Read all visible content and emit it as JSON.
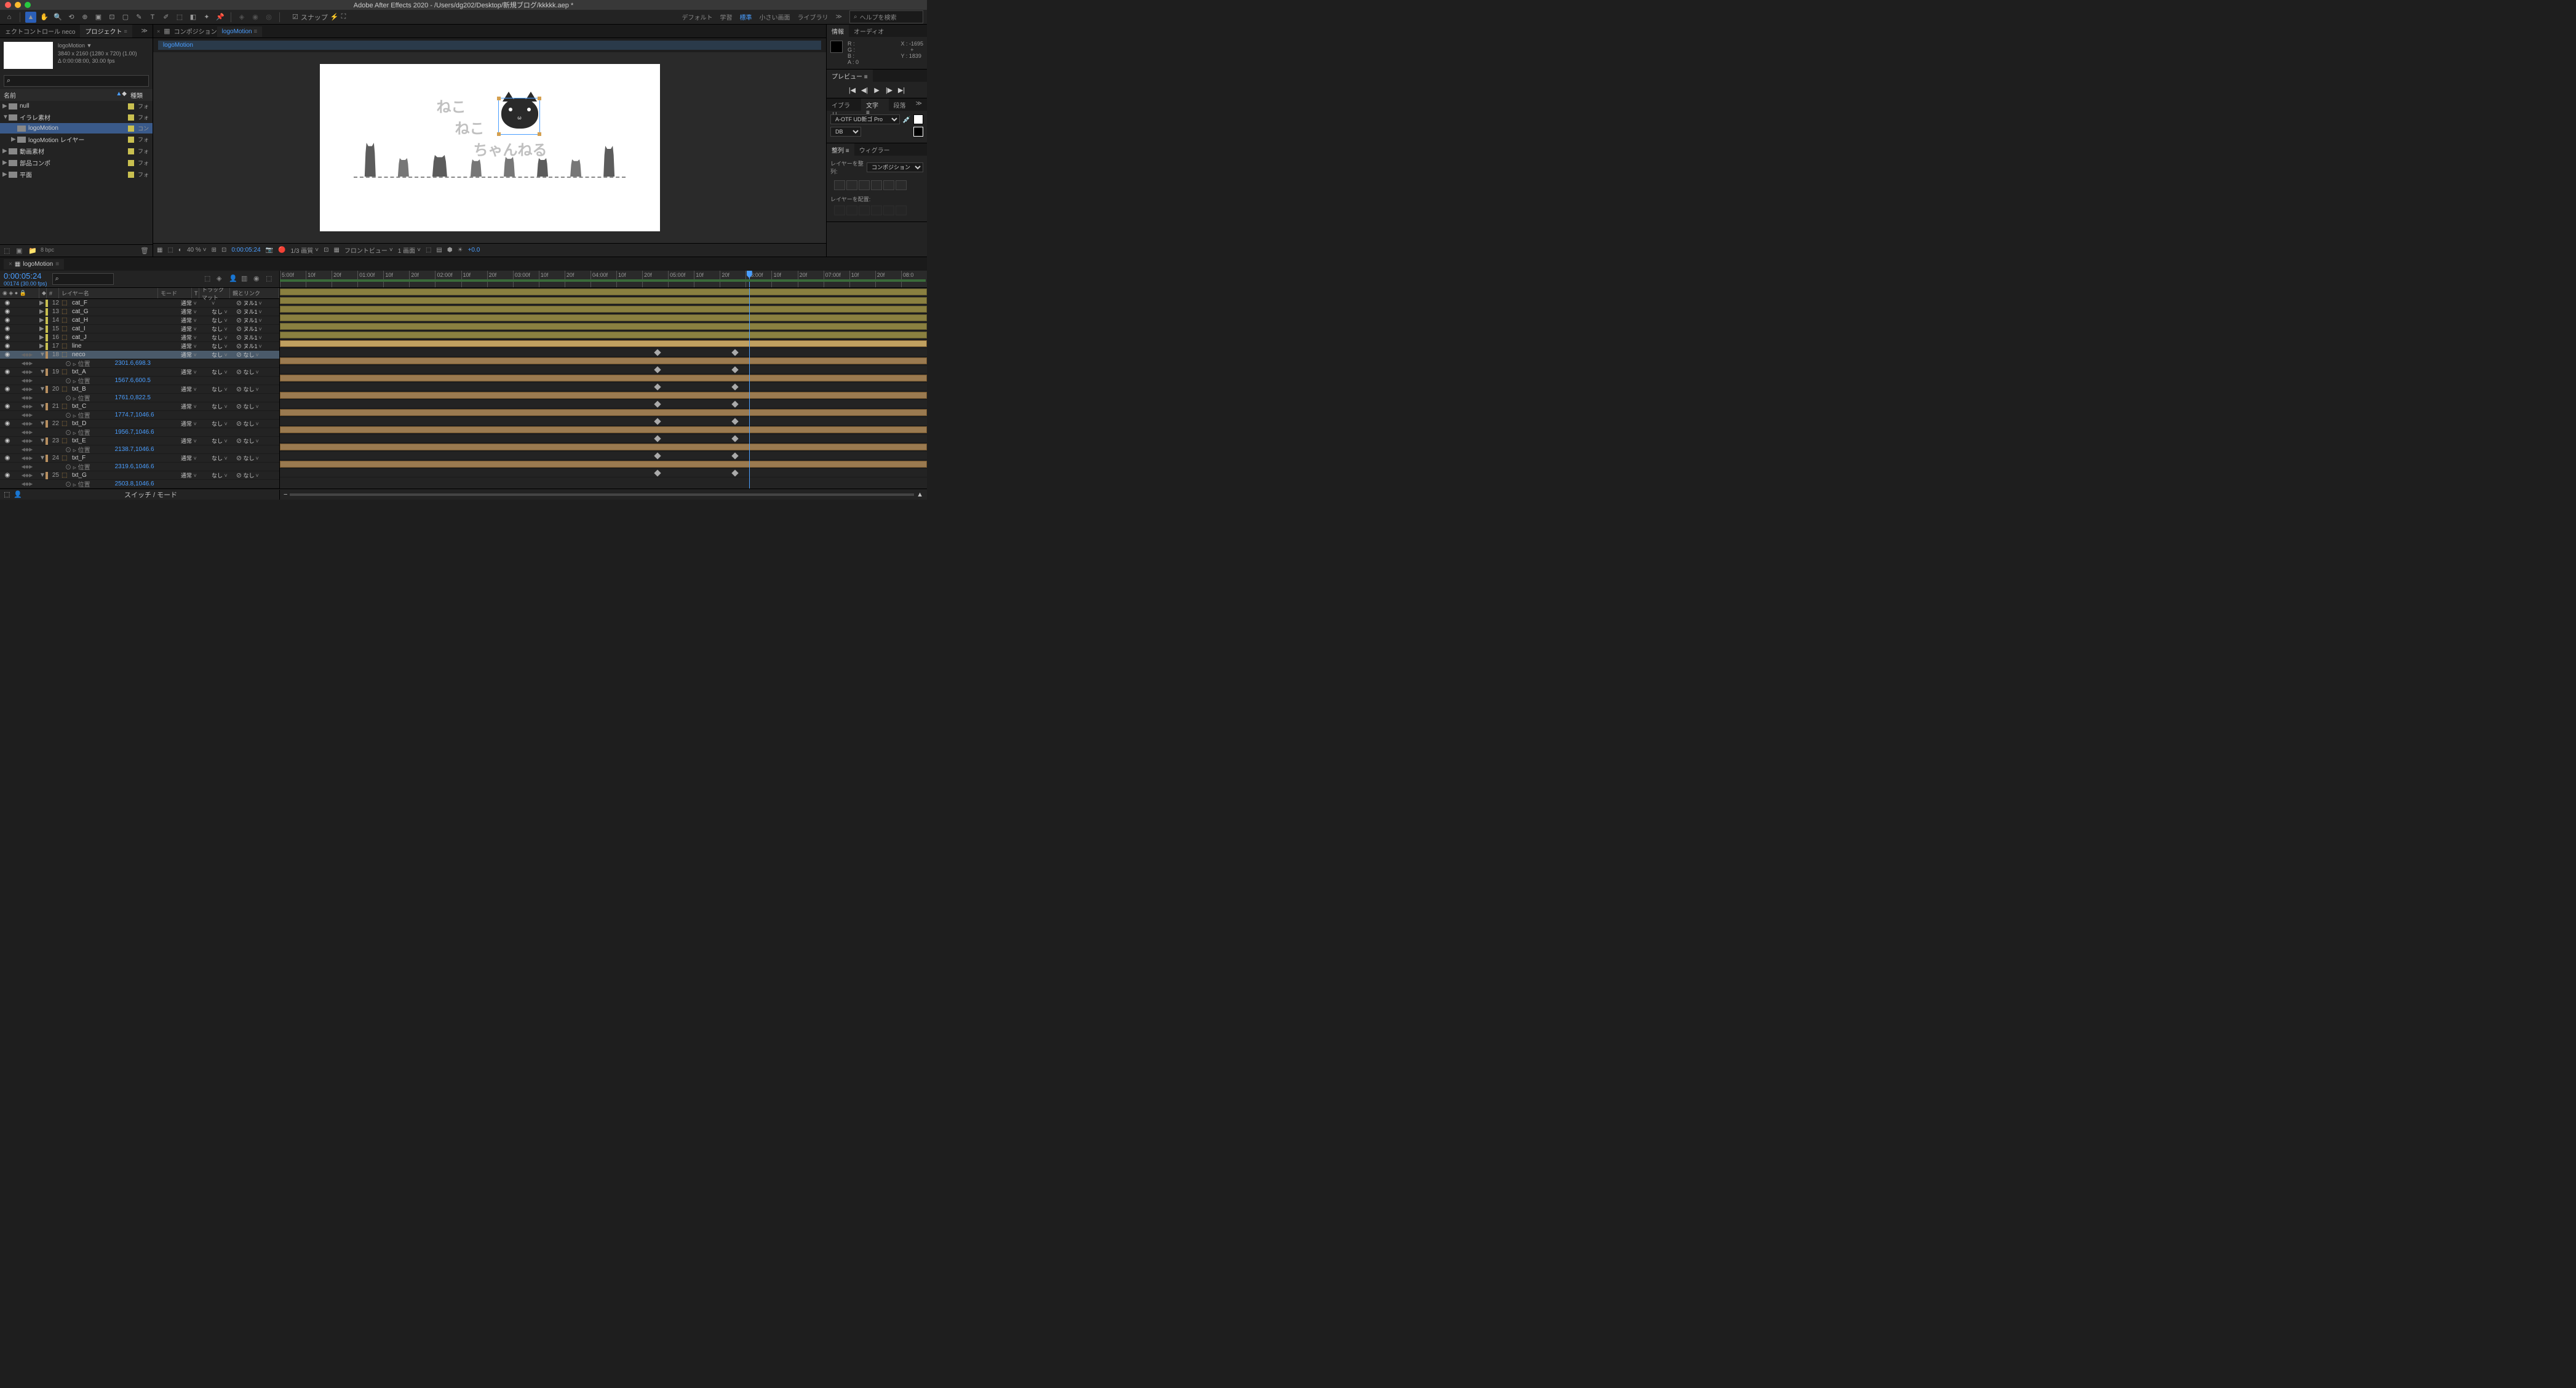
{
  "title": "Adobe After Effects 2020 - /Users/dg202/Desktop/新規ブログ/kkkkk.aep *",
  "toolbar": {
    "snap": "スナップ"
  },
  "workspaces": [
    "デフォルト",
    "学習",
    "標準",
    "小さい画面",
    "ライブラリ"
  ],
  "workspace_active": 2,
  "search_placeholder": "ヘルプを検索",
  "left_panel": {
    "tab1": "ェクトコントロール neco",
    "tab2": "プロジェクト",
    "comp_name": "logoMotion",
    "comp_res": "3840 x 2160  (1280 x 720) (1.00)",
    "comp_dur": "Δ 0:00:08:00, 30.00 fps",
    "header_name": "名前",
    "header_type": "種類",
    "items": [
      {
        "name": "null",
        "type": "フォ",
        "indent": 0,
        "arrow": "▶",
        "icon": "folder"
      },
      {
        "name": "イラレ素材",
        "type": "フォ",
        "indent": 0,
        "arrow": "▼",
        "icon": "folder"
      },
      {
        "name": "logoMotion",
        "type": "コン",
        "indent": 1,
        "arrow": "",
        "icon": "comp",
        "selected": true
      },
      {
        "name": "logoMotion レイヤー",
        "type": "フォ",
        "indent": 1,
        "arrow": "▶",
        "icon": "folder"
      },
      {
        "name": "動画素材",
        "type": "フォ",
        "indent": 0,
        "arrow": "▶",
        "icon": "folder"
      },
      {
        "name": "部品コンポ",
        "type": "フォ",
        "indent": 0,
        "arrow": "▶",
        "icon": "folder"
      },
      {
        "name": "平面",
        "type": "フォ",
        "indent": 0,
        "arrow": "▶",
        "icon": "folder"
      }
    ],
    "bpc": "8 bpc"
  },
  "center": {
    "tab_prefix": "コンポジション",
    "tab_name": "logoMotion",
    "breadcrumb": "logoMotion",
    "text_top": "ねこ",
    "text_mid": "ねこ",
    "text_bot": "ちゃんねる",
    "footer": {
      "zoom": "40 %",
      "time": "0:00:05:24",
      "quality": "1/3 画質",
      "view": "フロントビュー",
      "screens": "1 画面",
      "exposure": "+0.0"
    }
  },
  "info": {
    "tab1": "情報",
    "tab2": "オーディオ",
    "r": "R :",
    "g": "G :",
    "b": "B :",
    "a": "A :  0",
    "x": "X :  -1695",
    "y": "Y :  1839"
  },
  "preview": {
    "tab": "プレビュー"
  },
  "char": {
    "tab1": "イブラリ",
    "tab2": "文字",
    "tab3": "段落",
    "font": "A-OTF UD新ゴ Pro",
    "style": "DB"
  },
  "align": {
    "tab1": "整列",
    "tab2": "ウィグラー",
    "align_to": "レイヤーを整列:",
    "align_target": "コンポジション",
    "distribute": "レイヤーを配置:"
  },
  "timeline": {
    "tab": "logoMotion",
    "time": "0:00:05:24",
    "frames": "00174 (30.00 fps)",
    "col_num": "#",
    "col_name": "レイヤー名",
    "col_mode": "モード",
    "col_t": "T",
    "col_trkmat": "トラックマット",
    "col_parent": "親とリンク",
    "mode_normal": "通常",
    "trkmat_none": "なし",
    "parent_null": "ヌル1",
    "parent_none": "なし",
    "prop_pos": "位置",
    "ruler": [
      "5:00f",
      "10f",
      "20f",
      "01:00f",
      "10f",
      "20f",
      "02:00f",
      "10f",
      "20f",
      "03:00f",
      "10f",
      "20f",
      "04:00f",
      "10f",
      "20f",
      "05:00f",
      "10f",
      "20f",
      "06:00f",
      "10f",
      "20f",
      "07:00f",
      "10f",
      "20f",
      "08:0"
    ],
    "layers": [
      {
        "num": 12,
        "name": "cat_F",
        "parent": "ヌル1",
        "color": "yellow"
      },
      {
        "num": 13,
        "name": "cat_G",
        "parent": "ヌル1",
        "color": "yellow"
      },
      {
        "num": 14,
        "name": "cat_H",
        "parent": "ヌル1",
        "color": "yellow"
      },
      {
        "num": 15,
        "name": "cat_I",
        "parent": "ヌル1",
        "color": "yellow"
      },
      {
        "num": 16,
        "name": "cat_J",
        "parent": "ヌル1",
        "color": "yellow"
      },
      {
        "num": 17,
        "name": "line",
        "parent": "ヌル1",
        "color": "yellow"
      },
      {
        "num": 18,
        "name": "neco",
        "parent": "なし",
        "color": "tan",
        "selected": true,
        "expanded": true,
        "pos": "2301.6,698.3"
      },
      {
        "num": 19,
        "name": "txt_A",
        "parent": "なし",
        "color": "tan",
        "expanded": true,
        "pos": "1567.6,600.5"
      },
      {
        "num": 20,
        "name": "txt_B",
        "parent": "なし",
        "color": "tan",
        "expanded": true,
        "pos": "1761.0,822.5"
      },
      {
        "num": 21,
        "name": "txt_C",
        "parent": "なし",
        "color": "tan",
        "expanded": true,
        "pos": "1774.7,1046.6"
      },
      {
        "num": 22,
        "name": "txt_D",
        "parent": "なし",
        "color": "tan",
        "expanded": true,
        "pos": "1956.7,1046.6"
      },
      {
        "num": 23,
        "name": "txt_E",
        "parent": "なし",
        "color": "tan",
        "expanded": true,
        "pos": "2138.7,1046.6"
      },
      {
        "num": 24,
        "name": "txt_F",
        "parent": "なし",
        "color": "tan",
        "expanded": true,
        "pos": "2319.6,1046.6"
      },
      {
        "num": 25,
        "name": "txt_G",
        "parent": "なし",
        "color": "tan",
        "expanded": true,
        "pos": "2503.8,1046.6"
      }
    ],
    "footer_label": "スイッチ / モード"
  }
}
